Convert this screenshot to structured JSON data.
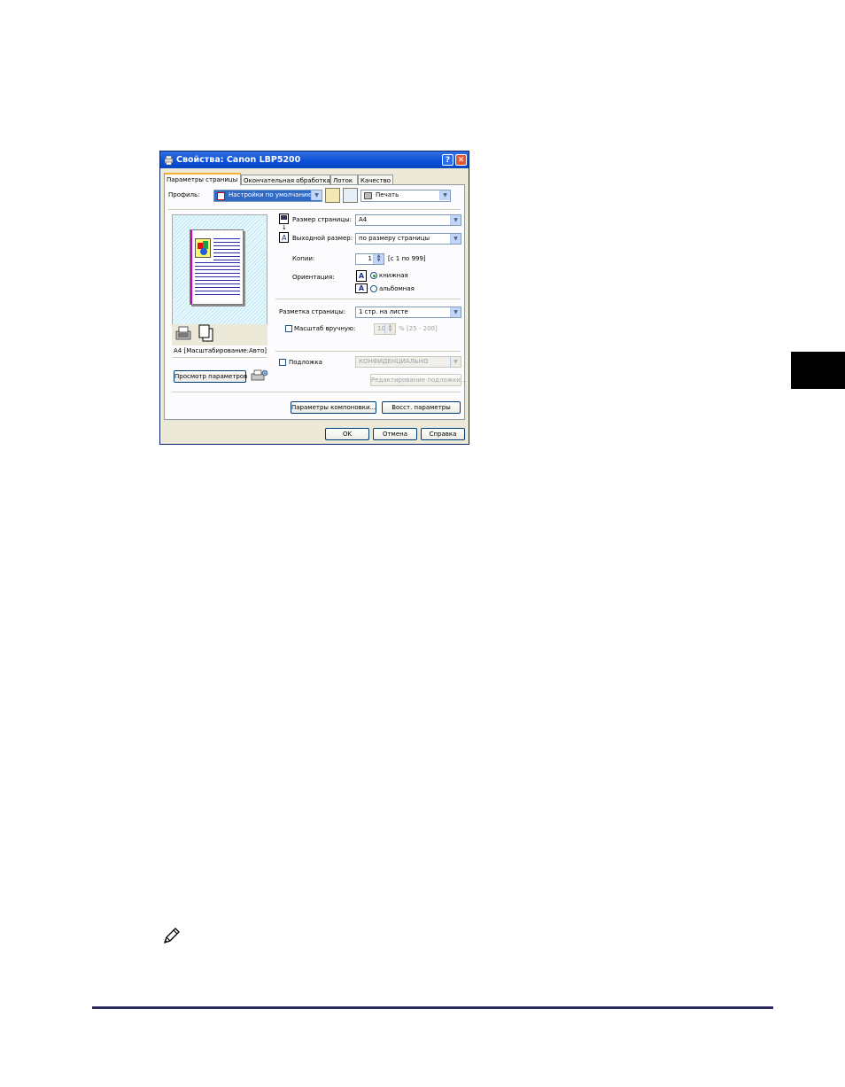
{
  "window": {
    "title": "Свойства: Canon LBP5200",
    "help_glyph": "?",
    "close_glyph": "✕"
  },
  "tabs": [
    {
      "label": "Параметры страницы",
      "active": true
    },
    {
      "label": "Окончательная обработка",
      "active": false
    },
    {
      "label": "Лоток",
      "active": false
    },
    {
      "label": "Качество",
      "active": false
    }
  ],
  "profile": {
    "label": "Профиль:",
    "value": "Настройки по умолчанию",
    "output_value": "Печать"
  },
  "page_size": {
    "label": "Размер страницы:",
    "value": "A4"
  },
  "output_size": {
    "label": "Выходной размер:",
    "value": "по размеру страницы"
  },
  "copies": {
    "label": "Копии:",
    "value": "1",
    "range": "[с 1 по 999]"
  },
  "orientation": {
    "label": "Ориентация:",
    "portrait": "книжная",
    "landscape": "альбомная",
    "selected": "portrait",
    "icon_glyph": "A"
  },
  "layout": {
    "label": "Разметка страницы:",
    "value": "1 стр. на листе"
  },
  "scaling": {
    "label": "Масштаб вручную:",
    "value": "100",
    "unit": "%",
    "range": "[25 - 200]",
    "checked": false
  },
  "watermark": {
    "label": "Подложка",
    "value": "КОНФИДЕНЦИАЛЬНО",
    "checked": false,
    "edit_button": "Редактирование подложки..."
  },
  "preview": {
    "caption": "A4 [Масштабирование:Авто]",
    "view_button": "Просмотр параметров"
  },
  "buttons": {
    "layout_params": "Параметры компоновки...",
    "restore": "Восст. параметры",
    "ok": "OK",
    "cancel": "Отмена",
    "help": "Справка"
  },
  "colors": {
    "titlebar": "#0a4fd8",
    "dialog_bg": "#ece9d8",
    "panel_bg": "#fcfcfe",
    "accent_tab": "#f7b037",
    "page_tab": "#000000",
    "rule": "#2a2a5a"
  }
}
